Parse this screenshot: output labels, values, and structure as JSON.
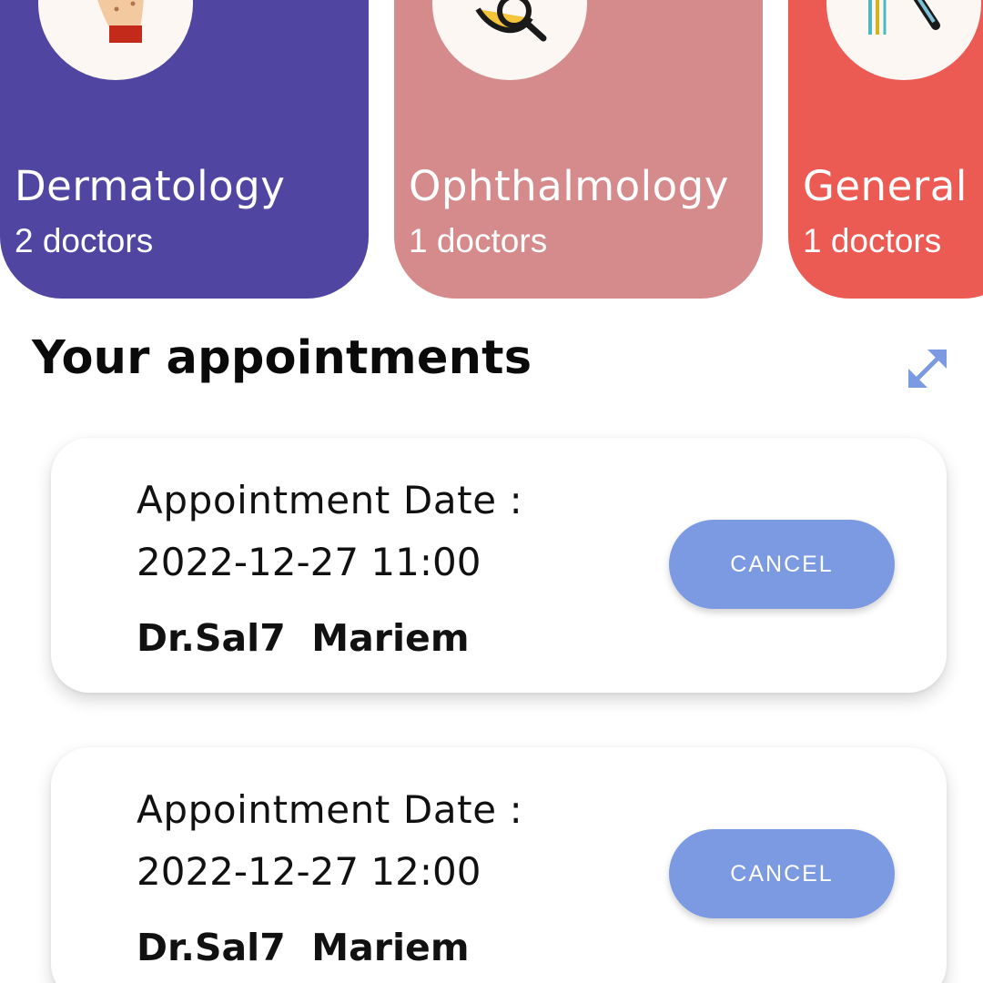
{
  "specialties": [
    {
      "name": "Dermatology",
      "count": "2 doctors",
      "color": "#5046a2",
      "icon": "hand-skin-icon"
    },
    {
      "name": "Ophthalmology",
      "count": "1 doctors",
      "color": "#d58a8c",
      "icon": "eye-magnifier-icon"
    },
    {
      "name": "General Surgery",
      "count": "1 doctors",
      "color": "#ec5b53",
      "icon": "surgical-tools-icon"
    }
  ],
  "appointments_section": {
    "title": "Your appointments",
    "expand_icon": "expand-icon",
    "accent": "#7b9ae2"
  },
  "appointments": [
    {
      "label": "Appointment Date :",
      "date": "2022-12-27  11:00",
      "doctor": "Dr.Sal7  Mariem",
      "cancel_label": "CANCEL"
    },
    {
      "label": "Appointment Date :",
      "date": "2022-12-27  12:00",
      "doctor": "Dr.Sal7  Mariem",
      "cancel_label": "CANCEL"
    }
  ]
}
